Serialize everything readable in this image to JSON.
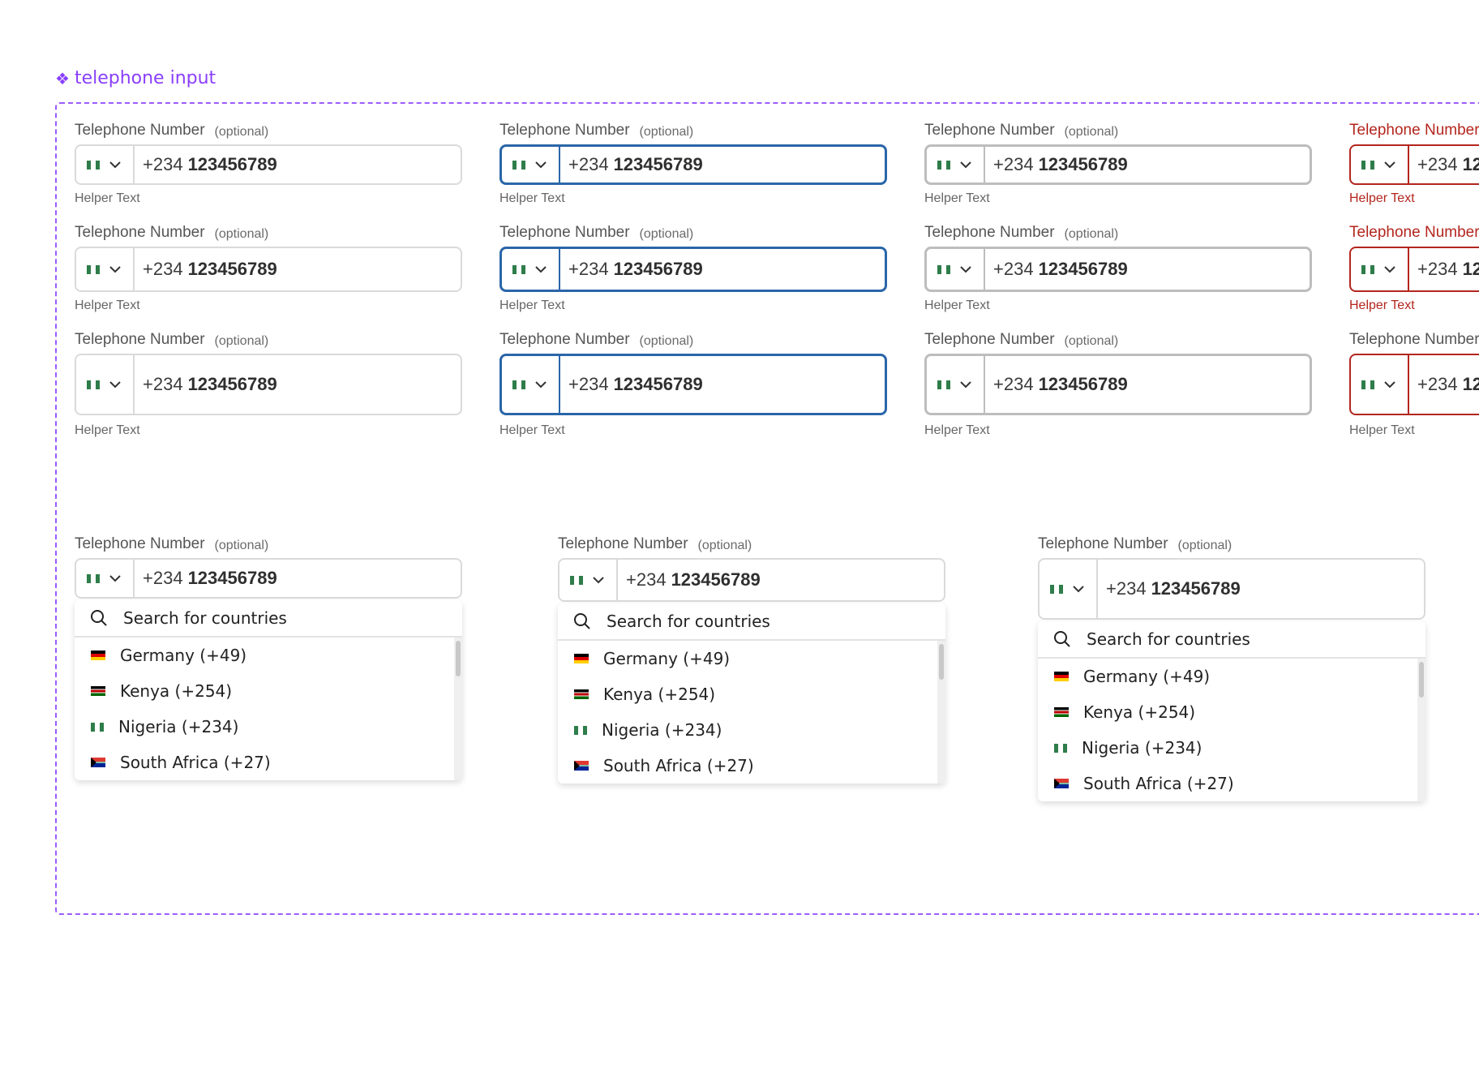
{
  "component_title": "telephone input",
  "field": {
    "label": "Telephone Number",
    "optional": "(optional)",
    "dial_code": "+234",
    "number": "123456789",
    "helper": "Helper Text",
    "country_flag": "nigeria-flag-icon"
  },
  "dropdown": {
    "search_placeholder": "Search for countries",
    "countries": [
      {
        "name": "Germany (+49)",
        "flag": "germany-flag-icon"
      },
      {
        "name": "Kenya (+254)",
        "flag": "kenya-flag-icon"
      },
      {
        "name": "Nigeria (+234)",
        "flag": "nigeria-flag-icon"
      },
      {
        "name": "South Africa (+27)",
        "flag": "south-africa-flag-icon"
      }
    ]
  },
  "colors": {
    "accent": "#8a3ffc",
    "focus": "#2a66a8",
    "error": "#b3261e",
    "border": "#dadada"
  }
}
